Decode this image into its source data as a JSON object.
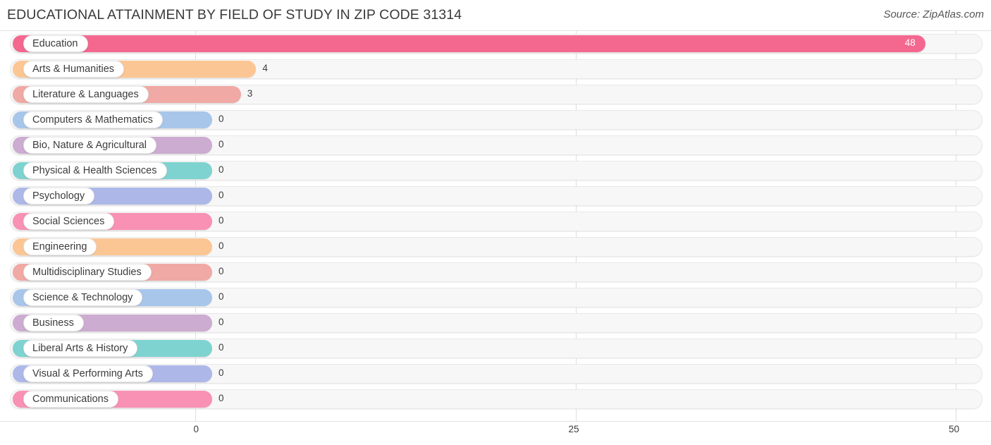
{
  "header": {
    "title": "EDUCATIONAL ATTAINMENT BY FIELD OF STUDY IN ZIP CODE 31314",
    "source": "Source: ZipAtlas.com"
  },
  "chart_data": {
    "type": "bar",
    "orientation": "horizontal",
    "title": "EDUCATIONAL ATTAINMENT BY FIELD OF STUDY IN ZIP CODE 31314",
    "xlabel": "",
    "ylabel": "",
    "xlim": [
      0,
      50
    ],
    "xticks": [
      0,
      25,
      50
    ],
    "xtick_labels": [
      "0",
      "25",
      "50"
    ],
    "grid": true,
    "legend": false,
    "categories": [
      "Education",
      "Arts & Humanities",
      "Literature & Languages",
      "Computers & Mathematics",
      "Bio, Nature & Agricultural",
      "Physical & Health Sciences",
      "Psychology",
      "Social Sciences",
      "Engineering",
      "Multidisciplinary Studies",
      "Science & Technology",
      "Business",
      "Liberal Arts & History",
      "Visual & Performing Arts",
      "Communications"
    ],
    "values": [
      48,
      4,
      3,
      0,
      0,
      0,
      0,
      0,
      0,
      0,
      0,
      0,
      0,
      0,
      0
    ],
    "value_labels": [
      "48",
      "4",
      "3",
      "0",
      "0",
      "0",
      "0",
      "0",
      "0",
      "0",
      "0",
      "0",
      "0",
      "0",
      "0"
    ],
    "colors": [
      "#f4688f",
      "#fcc694",
      "#f0a9a4",
      "#a8c6ea",
      "#ccacd0",
      "#7ed3d0",
      "#aeb8e8",
      "#f891b4",
      "#fcc694",
      "#f0a9a4",
      "#a8c6ea",
      "#ccacd0",
      "#7ed3d0",
      "#aeb8e8",
      "#f891b4"
    ]
  }
}
